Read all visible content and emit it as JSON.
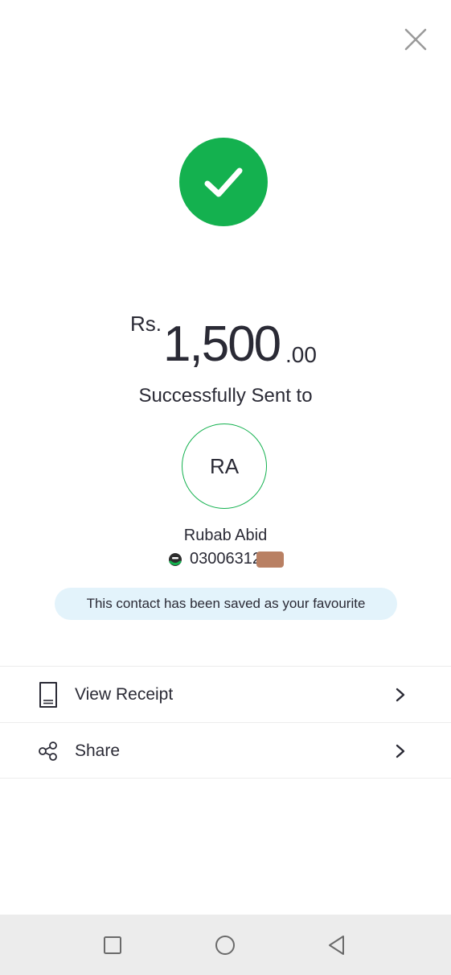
{
  "header": {
    "close_icon": "close-icon"
  },
  "status": {
    "icon": "checkmark-icon",
    "accent_color": "#14b14f"
  },
  "amount": {
    "currency": "Rs.",
    "whole": "1,500",
    "cents": ".00"
  },
  "message": {
    "sent_label": "Successfully Sent to"
  },
  "recipient": {
    "initials": "RA",
    "name": "Rubab Abid",
    "number": "03006312",
    "number_redacted": true,
    "wallet_icon": "wallet-logo-icon"
  },
  "favourite": {
    "text": "This contact has been saved as your favourite",
    "background": "#e3f3fb"
  },
  "actions": [
    {
      "label": "View Receipt",
      "icon": "receipt-icon"
    },
    {
      "label": "Share",
      "icon": "share-icon"
    }
  ],
  "nav": {
    "recent_icon": "square-icon",
    "home_icon": "circle-icon",
    "back_icon": "triangle-back-icon",
    "background": "#ececec"
  }
}
